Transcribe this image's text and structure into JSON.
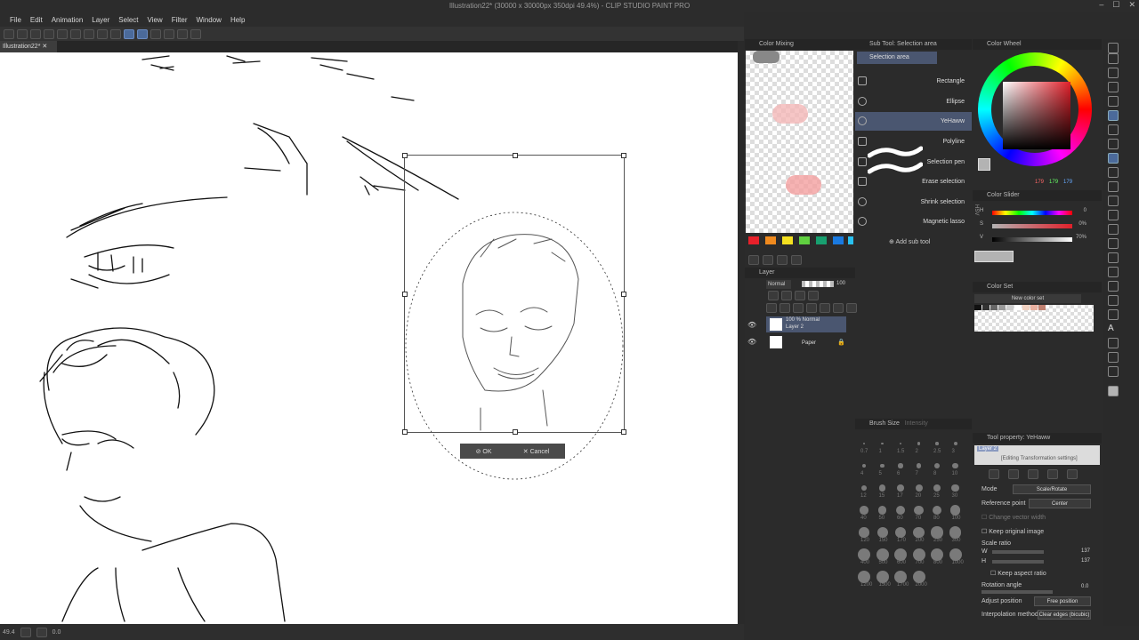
{
  "window": {
    "title": "Illustration22* (30000 x 30000px 350dpi 49.4%) - CLIP STUDIO PAINT PRO"
  },
  "menu": [
    "File",
    "Edit",
    "Animation",
    "Layer",
    "Select",
    "View",
    "Filter",
    "Window",
    "Help"
  ],
  "doc_tab": "Illustration22*",
  "transform_bar": {
    "ok": "OK",
    "cancel": "Cancel"
  },
  "status": {
    "zoom": "49.4",
    "angle": "0.0"
  },
  "color_mixing": {
    "title": "Color Mixing",
    "swatches": [
      "#e8202a",
      "#f08a1e",
      "#f4e020",
      "#60d040",
      "#18a070",
      "#1a7ae0",
      "#28c0f0"
    ]
  },
  "sub_tool": {
    "title": "Sub Tool: Selection area",
    "group": "Selection area",
    "items": [
      "Rectangle",
      "Ellipse",
      "YeHaww",
      "Polyline",
      "Selection pen",
      "Erase selection",
      "Shrink selection",
      "Magnetic lasso"
    ],
    "selected": "YeHaww",
    "add": "Add sub tool"
  },
  "color_wheel": {
    "title": "Color Wheel",
    "values": [
      "179",
      "179",
      "179"
    ]
  },
  "color_slider": {
    "title": "Color Slider",
    "mode": "HSV",
    "h": "0",
    "s": "0%",
    "v": "70%",
    "labels": [
      "H",
      "S",
      "V"
    ]
  },
  "color_set": {
    "title": "Color Set",
    "set": "New color set"
  },
  "layer": {
    "title": "Layer",
    "blend": "Normal",
    "opacity": "100",
    "layers": [
      {
        "line1": "100 % Normal",
        "line2": "Layer 2"
      },
      {
        "line1": "",
        "line2": "Paper"
      }
    ]
  },
  "brush_size": {
    "title": "Brush Size",
    "tab2": "Intensity",
    "sizes": [
      "0.7",
      "1",
      "1.5",
      "2",
      "2.5",
      "3",
      "4",
      "5",
      "6",
      "7",
      "8",
      "10",
      "12",
      "15",
      "17",
      "20",
      "25",
      "30",
      "40",
      "50",
      "60",
      "70",
      "80",
      "100",
      "120",
      "150",
      "170",
      "200",
      "250",
      "300",
      "400",
      "500",
      "600",
      "700",
      "800",
      "1000",
      "1200",
      "1500",
      "1700",
      "2000"
    ]
  },
  "tool_property": {
    "title": "Tool property: YeHaww",
    "preview_label": "Layer 2",
    "editing": "[Editing Transformation settings]",
    "mode_label": "Mode",
    "mode_value": "Scale/Rotate",
    "ref_label": "Reference point",
    "ref_value": "Center",
    "change_vector": "Change vector width",
    "keep_original": "Keep original image",
    "scale_ratio": "Scale ratio",
    "w_label": "W",
    "w_value": "137",
    "h_label": "H",
    "h_value": "137",
    "keep_aspect": "Keep aspect ratio",
    "rotation_label": "Rotation angle",
    "rotation_value": "0.0",
    "adjust_label": "Adjust position",
    "adjust_value": "Free position",
    "interp_label": "Interpolation method",
    "interp_value": "Clear edges (bicubic)"
  }
}
